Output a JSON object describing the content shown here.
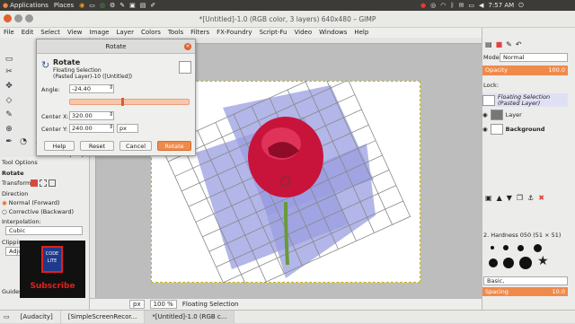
{
  "top_panel": {
    "applications": "Applications",
    "places": "Places",
    "clock": "7:57 AM"
  },
  "window_title": "*[Untitled]-1.0 (RGB color, 3 layers) 640x480 – GIMP",
  "menu": [
    "File",
    "Edit",
    "Select",
    "View",
    "Image",
    "Layer",
    "Colors",
    "Tools",
    "Filters",
    "FX-Foundry",
    "Script-Fu",
    "Video",
    "Windows",
    "Help"
  ],
  "dialog": {
    "title": "Rotate",
    "heading": "Rotate",
    "subtitle1": "Floating Selection",
    "subtitle2": "(Pasted Layer)-10 ([Untitled])",
    "angle_label": "Angle:",
    "angle_value": "-24.40",
    "center_x_label": "Center X:",
    "center_x_value": "320.00",
    "center_y_label": "Center Y:",
    "center_y_value": "240.00",
    "unit": "px",
    "buttons": {
      "help": "Help",
      "reset": "Reset",
      "cancel": "Cancel",
      "rotate": "Rotate"
    }
  },
  "tool_options": {
    "title": "Tool Options",
    "tool_name": "Rotate",
    "transform_label": "Transform:",
    "direction_label": "Direction",
    "dir_normal": "Normal (Forward)",
    "dir_corrective": "Corrective (Backward)",
    "interpolation_label": "Interpolation:",
    "interpolation_value": "Cubic",
    "clipping_label": "Clipping",
    "clipping_value": "Adjust",
    "guides_label": "Guides"
  },
  "subscribe": {
    "badge": "CODE LITE",
    "text": "Subscribe"
  },
  "status": {
    "unit": "px",
    "zoom": "100 %",
    "message": "Floating Selection"
  },
  "layers": {
    "mode_label": "Mode:",
    "mode_value": "Normal",
    "opacity_label": "Opacity",
    "opacity_value": "100.0",
    "lock_label": "Lock:",
    "items": [
      {
        "name": "Floating Selection",
        "sub": "(Pasted Layer)"
      },
      {
        "name": "Layer"
      },
      {
        "name": "Background"
      }
    ]
  },
  "brushes": {
    "brush_name": "2. Hardness 050 (51 × 51)",
    "preset_value": "Basic,",
    "spacing_label": "Spacing",
    "spacing_value": "10.0"
  },
  "taskbar": [
    "[Audacity]",
    "[SimpleScreenRecor...",
    "*[Untitled]-1.0 (RGB c..."
  ]
}
